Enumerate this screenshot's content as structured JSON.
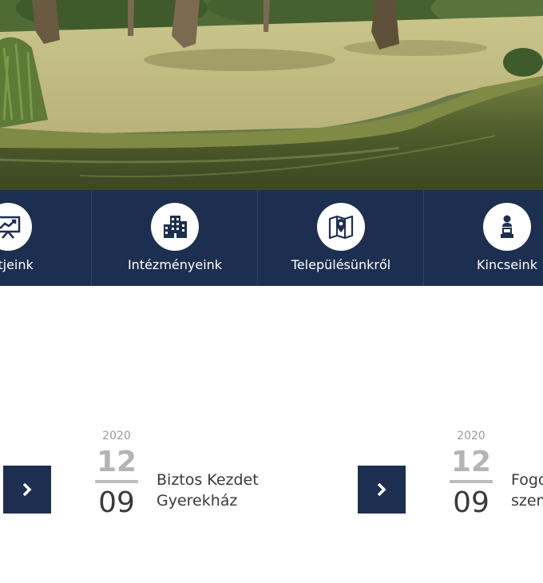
{
  "nav": {
    "items": [
      {
        "label": "ektjeink",
        "icon": "presentation-chart-icon"
      },
      {
        "label": "Intézményeink",
        "icon": "buildings-icon"
      },
      {
        "label": "Településünkről",
        "icon": "map-pin-icon"
      },
      {
        "label": "Kincseink",
        "icon": "bust-statue-icon"
      }
    ]
  },
  "news": [
    {
      "year": "2020",
      "day": "12",
      "month": "09",
      "title_line1": "Biztos Kezdet",
      "title_line2": "Gyerekház"
    },
    {
      "year": "2020",
      "day": "12",
      "month": "09",
      "title_line1": "Fogo",
      "title_line2": "szem"
    }
  ],
  "colors": {
    "navy": "#1d2f50",
    "date_grey": "#b4b4b4",
    "text_dark": "#3a3a3a"
  }
}
